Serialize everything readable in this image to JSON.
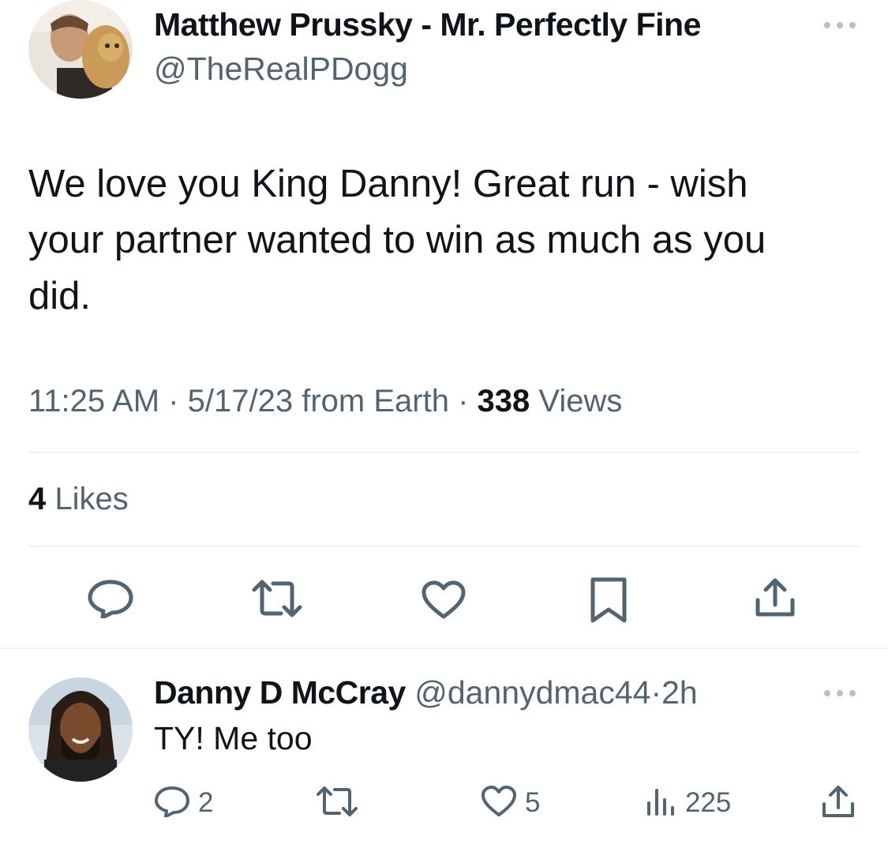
{
  "main_tweet": {
    "author_name": "Matthew Prussky - Mr. Perfectly Fine",
    "author_handle": "@TheRealPDogg",
    "text": "We love you King Danny! Great run - wish your partner wanted to win as much as you did.",
    "time": "11:25 AM",
    "date": "5/17/23",
    "source": "from Earth",
    "views_count": "338",
    "views_label": "Views",
    "likes_count": "4",
    "likes_label": "Likes",
    "sep": "·"
  },
  "reply": {
    "author_name": "Danny D McCray",
    "author_handle": "@dannydmac44",
    "sep": "·",
    "time": "2h",
    "text": "TY! Me too",
    "reply_count": "2",
    "like_count": "5",
    "views_count": "225"
  },
  "icons": {
    "main_actions": [
      "reply-icon",
      "retweet-icon",
      "like-icon",
      "bookmark-icon",
      "share-icon"
    ],
    "reply_actions": [
      "reply-icon",
      "retweet-icon",
      "like-icon",
      "views-icon",
      "share-icon"
    ]
  },
  "colors": {
    "text": "#0f1419",
    "secondary": "#536471",
    "divider": "#eff3f4"
  }
}
